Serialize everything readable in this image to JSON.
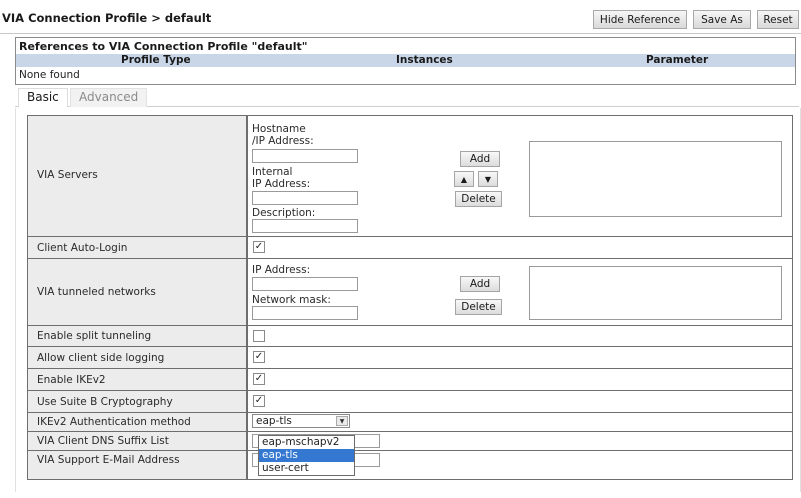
{
  "header": {
    "title": "VIA Connection Profile > default",
    "buttons": {
      "hide_reference": "Hide Reference",
      "save_as": "Save As",
      "reset": "Reset"
    }
  },
  "references": {
    "title": "References to VIA Connection Profile \"default\"",
    "columns": [
      "Profile Type",
      "Instances",
      "Parameter"
    ],
    "empty_text": "None found"
  },
  "tabs": [
    "Basic",
    "Advanced"
  ],
  "form": {
    "via_servers": {
      "label": "VIA Servers",
      "hostname_label_1": "Hostname",
      "hostname_label_2": "/IP Address:",
      "internal_label_1": "Internal",
      "internal_label_2": "IP Address:",
      "description_label": "Description:",
      "add": "Add",
      "up": "▲",
      "down": "▼",
      "delete": "Delete"
    },
    "client_auto_login": {
      "label": "Client Auto-Login",
      "checked": "✓"
    },
    "tunneled_networks": {
      "label": "VIA tunneled networks",
      "ip_label": "IP Address:",
      "mask_label": "Network mask:",
      "add": "Add",
      "delete": "Delete"
    },
    "split_tunneling": {
      "label": "Enable split tunneling"
    },
    "client_logging": {
      "label": "Allow client side logging",
      "checked": "✓"
    },
    "ikev2": {
      "label": "Enable IKEv2",
      "checked": "✓"
    },
    "suite_b": {
      "label": "Use Suite B Cryptography",
      "checked": "✓"
    },
    "auth_method": {
      "label": "IKEv2 Authentication method",
      "selected": "eap-tls",
      "arrow": "▼",
      "options": [
        "eap-mschapv2",
        "eap-tls",
        "user-cert"
      ]
    },
    "dns_suffix": {
      "label": "VIA Client DNS Suffix List"
    },
    "support_email": {
      "label": "VIA Support E-Mail Address"
    }
  }
}
